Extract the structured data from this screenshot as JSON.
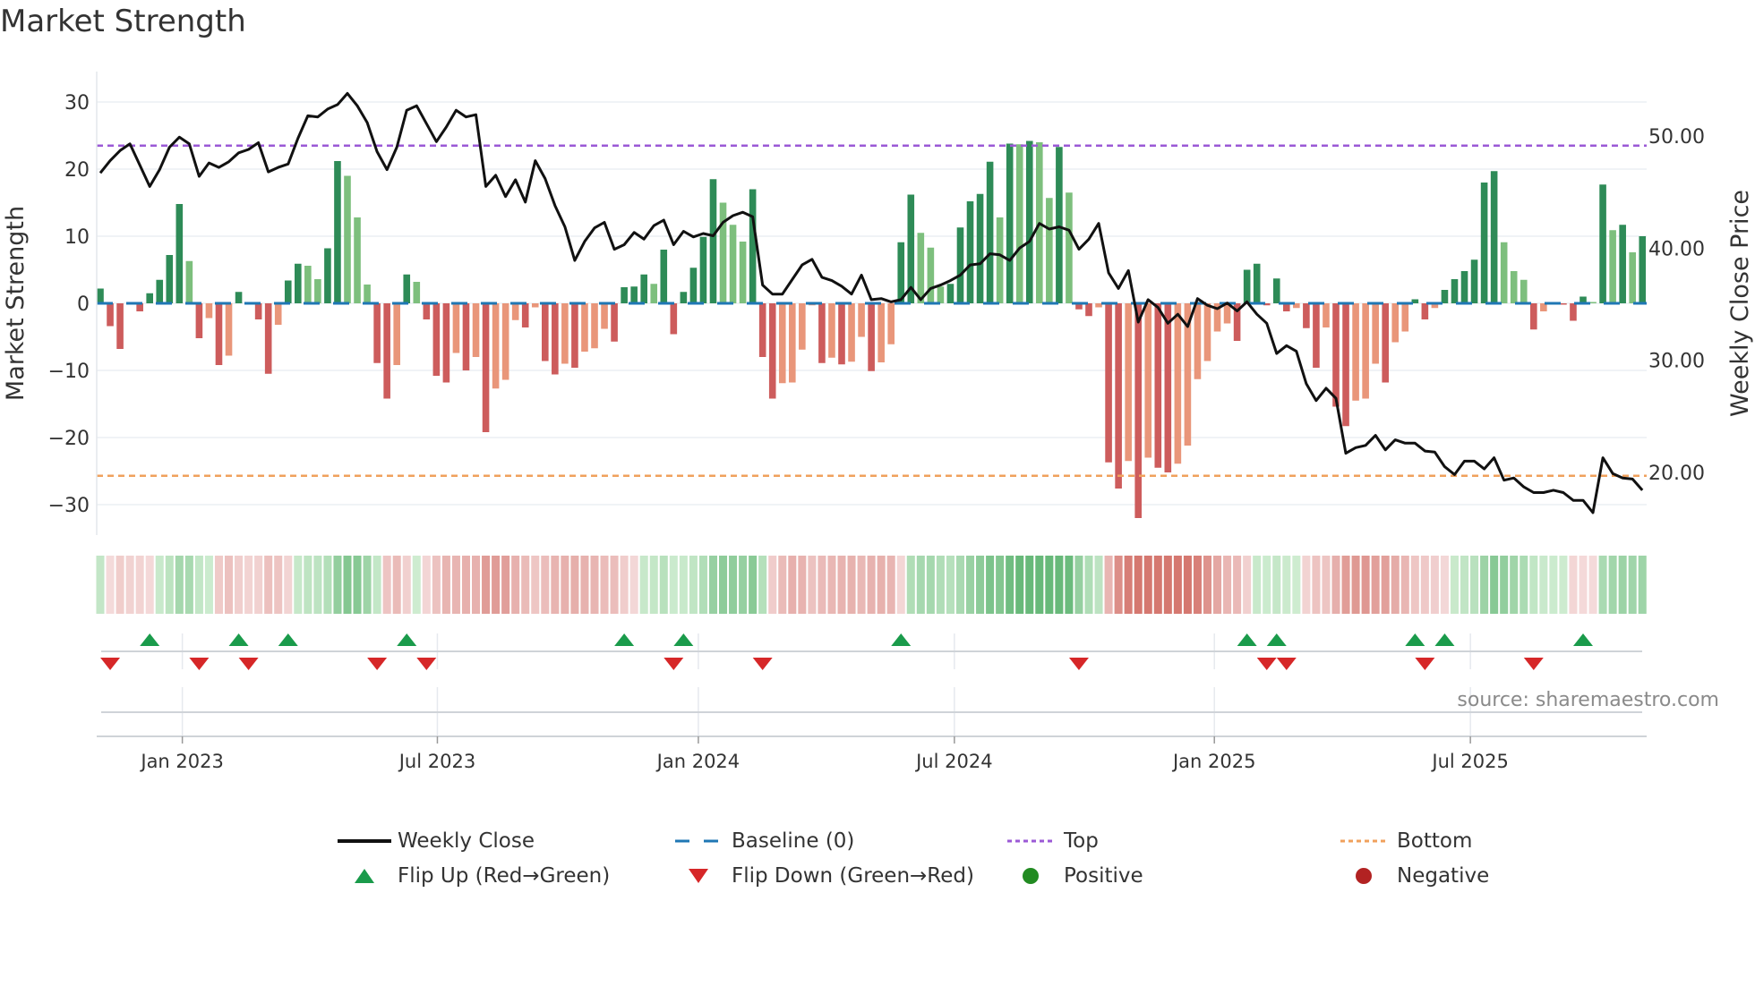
{
  "title": "Market Strength",
  "source": "source: sharemaestro.com",
  "legend": {
    "weekly_close": "Weekly Close",
    "baseline": "Baseline (0)",
    "top": "Top",
    "bottom": "Bottom",
    "flip_up": "Flip Up (Red→Green)",
    "flip_down": "Flip Down (Green→Red)",
    "positive": "Positive",
    "negative": "Negative"
  },
  "colors": {
    "pos_strong": "#2e8b57",
    "pos_weak": "#7dbf7d",
    "neg_strong": "#cd5c5c",
    "neg_weak": "#e9967a",
    "baseline": "#1f77b4",
    "top": "#9b59d6",
    "bottom": "#f0a15c",
    "flip_up": "#1a9b4b",
    "flip_down": "#d62728",
    "positive": "#228b22",
    "negative": "#b22222",
    "price": "#111111"
  },
  "chart_data": {
    "type": "bar",
    "title": "Market Strength",
    "ylabel": "Market Strength",
    "y2label": "Weekly Close Price",
    "ylim": [
      -34.5,
      34.5
    ],
    "yticks": [
      30,
      20,
      10,
      0,
      -10,
      -20,
      -30
    ],
    "ytick_labels": [
      "30",
      "20",
      "10",
      "0",
      "−10",
      "−20",
      "−30"
    ],
    "y2ticks": [
      50,
      40,
      30,
      20
    ],
    "y2tick_labels": [
      "50.00",
      "40.00",
      "30.00",
      "20.00"
    ],
    "x_unit": "week index",
    "xticks": [
      {
        "label": "Jan 2023",
        "week": 8.3
      },
      {
        "label": "Jul 2023",
        "week": 34.1
      },
      {
        "label": "Jan 2024",
        "week": 60.5
      },
      {
        "label": "Jul 2024",
        "week": 86.4
      },
      {
        "label": "Jan 2025",
        "week": 112.7
      },
      {
        "label": "Jul 2025",
        "week": 138.6
      }
    ],
    "top_level": 23.5,
    "bottom_level": -25.7,
    "strength": [
      2.2,
      -3.4,
      -6.8,
      -0.2,
      -1.2,
      1.5,
      3.5,
      7.2,
      14.8,
      6.3,
      -5.2,
      -2.2,
      -9.2,
      -7.8,
      1.7,
      -0.2,
      -2.4,
      -10.5,
      -3.2,
      3.4,
      5.9,
      5.6,
      3.6,
      8.2,
      21.2,
      19.0,
      12.8,
      2.8,
      -8.9,
      -14.2,
      -9.2,
      4.3,
      3.2,
      -2.4,
      -10.8,
      -11.8,
      -7.4,
      -10.0,
      -8.0,
      -19.2,
      -12.7,
      -11.4,
      -2.5,
      -3.6,
      -0.6,
      -8.6,
      -10.6,
      -9.0,
      -9.6,
      -7.2,
      -6.7,
      -3.8,
      -5.7,
      2.4,
      2.5,
      4.3,
      2.9,
      8.0,
      -4.6,
      1.7,
      5.3,
      9.9,
      18.5,
      15.0,
      11.7,
      9.2,
      17.0,
      -8.0,
      -14.2,
      -11.9,
      -11.8,
      -6.9,
      -0.3,
      -8.9,
      -8.1,
      -9.1,
      -8.7,
      -5.0,
      -10.1,
      -8.8,
      -6.1,
      9.1,
      16.2,
      10.5,
      8.3,
      2.5,
      2.9,
      11.3,
      15.2,
      16.3,
      21.1,
      12.8,
      23.8,
      23.7,
      24.2,
      24.0,
      15.7,
      23.3,
      16.5,
      -0.9,
      -1.9,
      -0.6,
      -23.7,
      -27.6,
      -23.5,
      -32.0,
      -23.0,
      -24.5,
      -25.2,
      -23.9,
      -21.2,
      -11.3,
      -8.6,
      -4.2,
      -3.0,
      -5.6,
      5.0,
      5.9,
      -0.3,
      3.7,
      -1.2,
      -0.7,
      -3.7,
      -9.6,
      -3.6,
      -15.4,
      -18.3,
      -14.5,
      -14.2,
      -9.0,
      -11.8,
      -5.8,
      -4.2,
      0.6,
      -2.4,
      -0.7,
      2.0,
      3.6,
      4.8,
      6.5,
      18.0,
      19.7,
      9.1,
      4.8,
      3.5,
      -3.9,
      -1.2,
      -0.2,
      -0.2,
      -2.6,
      1.0,
      0.2,
      17.7,
      10.9,
      11.7,
      7.6,
      10.0
    ],
    "weekly_close": [
      46.7,
      47.8,
      48.7,
      49.3,
      47.4,
      45.5,
      47.0,
      49.0,
      49.9,
      49.3,
      46.4,
      47.6,
      47.2,
      47.7,
      48.5,
      48.8,
      49.4,
      46.8,
      47.2,
      47.5,
      49.8,
      51.8,
      51.7,
      52.4,
      52.8,
      53.8,
      52.7,
      51.2,
      48.6,
      47.0,
      49.0,
      52.3,
      52.7,
      51.1,
      49.5,
      50.8,
      52.3,
      51.7,
      51.9,
      45.5,
      46.5,
      44.6,
      46.1,
      44.1,
      47.8,
      46.2,
      43.8,
      41.9,
      38.9,
      40.6,
      41.8,
      42.3,
      39.9,
      40.3,
      41.4,
      40.8,
      42.0,
      42.5,
      40.3,
      41.5,
      41.0,
      41.3,
      41.1,
      42.3,
      42.9,
      43.2,
      42.8,
      36.7,
      35.9,
      35.9,
      37.2,
      38.5,
      39.0,
      37.4,
      37.1,
      36.6,
      35.9,
      37.6,
      35.4,
      35.5,
      35.2,
      35.4,
      36.5,
      35.4,
      36.4,
      36.7,
      37.1,
      37.6,
      38.5,
      38.6,
      39.5,
      39.4,
      38.9,
      40.0,
      40.6,
      42.2,
      41.7,
      41.9,
      41.6,
      39.9,
      40.8,
      42.2,
      37.8,
      36.4,
      38.0,
      33.4,
      35.4,
      34.7,
      33.3,
      34.1,
      33.0,
      35.5,
      34.9,
      34.6,
      35.1,
      34.4,
      35.2,
      34.1,
      33.3,
      30.6,
      31.3,
      30.8,
      27.9,
      26.4,
      27.5,
      26.6,
      21.7,
      22.2,
      22.4,
      23.3,
      22.0,
      22.9,
      22.6,
      22.6,
      21.9,
      21.8,
      20.5,
      19.8,
      21.0,
      21.0,
      20.3,
      21.3,
      19.3,
      19.5,
      18.7,
      18.2,
      18.2,
      18.4,
      18.2,
      17.5,
      17.5,
      16.4,
      21.3,
      19.9,
      19.5,
      19.4,
      18.4
    ]
  }
}
